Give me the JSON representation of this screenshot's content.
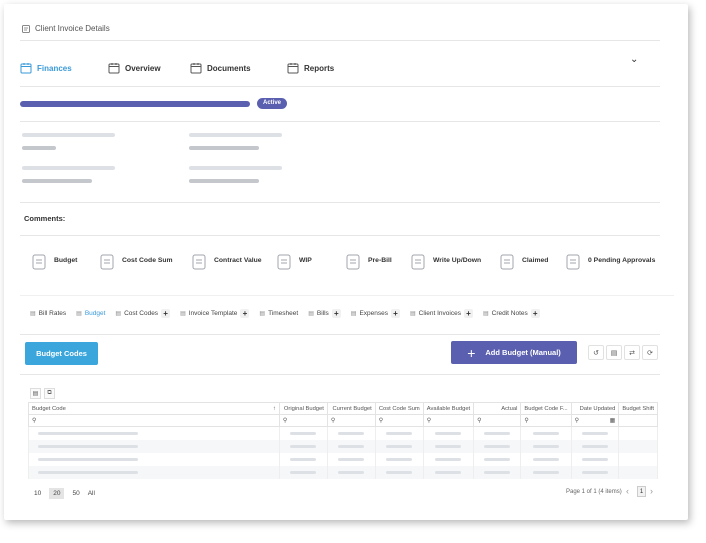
{
  "header": {
    "title": "Client Invoice Details"
  },
  "tabs": [
    {
      "label": "Finances",
      "active": true,
      "icon": "finances-icon"
    },
    {
      "label": "Overview",
      "active": false,
      "icon": "calendar-icon"
    },
    {
      "label": "Documents",
      "active": false,
      "icon": "calendar-icon"
    },
    {
      "label": "Reports",
      "active": false,
      "icon": "calendar-icon"
    }
  ],
  "status": {
    "badge": "Active",
    "progress": 1.0
  },
  "comments_label": "Comments:",
  "metrics": [
    {
      "label": "Budget",
      "icon": "piggy-bank-icon"
    },
    {
      "label": "Cost Code Sum",
      "icon": "stack-icon"
    },
    {
      "label": "Contract Value",
      "icon": "document-icon"
    },
    {
      "label": "WIP",
      "icon": "wip-icon"
    },
    {
      "label": "Pre-Bill",
      "icon": "coin-icon"
    },
    {
      "label": "Write Up/Down",
      "icon": "chart-up-icon"
    },
    {
      "label": "Claimed",
      "icon": "receipt-icon"
    },
    {
      "label": "0 Pending Approvals",
      "icon": "chat-icon"
    }
  ],
  "subtabs": [
    {
      "label": "Bill Rates",
      "active": false,
      "plus": false
    },
    {
      "label": "Budget",
      "active": true,
      "plus": false
    },
    {
      "label": "Cost Codes",
      "active": false,
      "plus": true
    },
    {
      "label": "Invoice Template",
      "active": false,
      "plus": true
    },
    {
      "label": "Timesheet",
      "active": false,
      "plus": false
    },
    {
      "label": "Bills",
      "active": false,
      "plus": true
    },
    {
      "label": "Expenses",
      "active": false,
      "plus": true
    },
    {
      "label": "Client Invoices",
      "active": false,
      "plus": true
    },
    {
      "label": "Credit Notes",
      "active": false,
      "plus": true
    }
  ],
  "buttons": {
    "budget_codes": "Budget Codes",
    "add_budget": "Add Budget (Manual)"
  },
  "grid": {
    "columns": [
      "Budget Code",
      "Original Budget",
      "Current Budget",
      "Cost Code Sum",
      "Available Budget",
      "Actual",
      "Budget Code F...",
      "Date Updated",
      "Budget Shift"
    ],
    "rows": 4
  },
  "pager": {
    "sizes": [
      "10",
      "20",
      "50",
      "All"
    ],
    "selected": "20",
    "info": "Page 1 of 1 (4 items)",
    "page": "1"
  },
  "colors": {
    "accent": "#3a9ad9",
    "primary": "#5a5fb0"
  }
}
